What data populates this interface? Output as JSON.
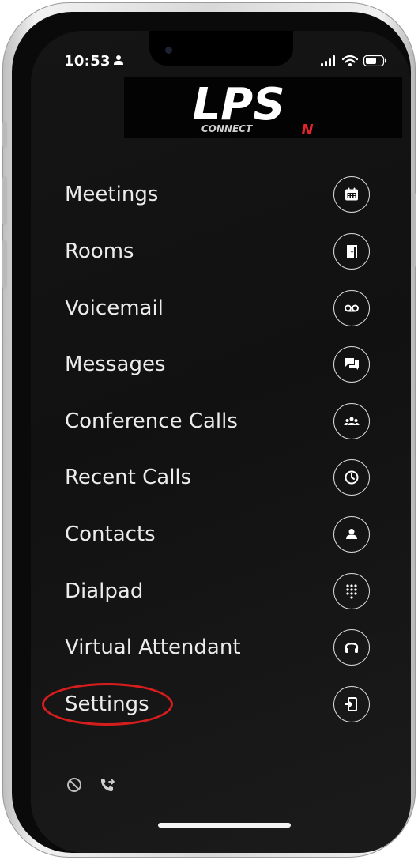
{
  "status_bar": {
    "time": "10:53"
  },
  "logo": {
    "main_text": "LPS",
    "sub_text": "CONNECT",
    "accent_mark": "N"
  },
  "menu": {
    "items": [
      {
        "label": "Meetings",
        "icon": "calendar-icon"
      },
      {
        "label": "Rooms",
        "icon": "door-icon"
      },
      {
        "label": "Voicemail",
        "icon": "voicemail-icon"
      },
      {
        "label": "Messages",
        "icon": "chat-bubbles-icon"
      },
      {
        "label": "Conference Calls",
        "icon": "group-icon"
      },
      {
        "label": "Recent Calls",
        "icon": "clock-icon"
      },
      {
        "label": "Contacts",
        "icon": "person-icon"
      },
      {
        "label": "Dialpad",
        "icon": "dialpad-icon"
      },
      {
        "label": "Virtual Attendant",
        "icon": "headset-icon"
      },
      {
        "label": "Settings",
        "icon": "settings-exit-icon"
      }
    ]
  },
  "annotation": {
    "highlighted_item": "Settings",
    "color": "#d51d1d"
  },
  "bottom_bar": {
    "icons": [
      "do-not-disturb-icon",
      "call-forward-icon"
    ]
  },
  "colors": {
    "background": "#121212",
    "text": "#ececec",
    "logo_accent": "#e0262b"
  }
}
